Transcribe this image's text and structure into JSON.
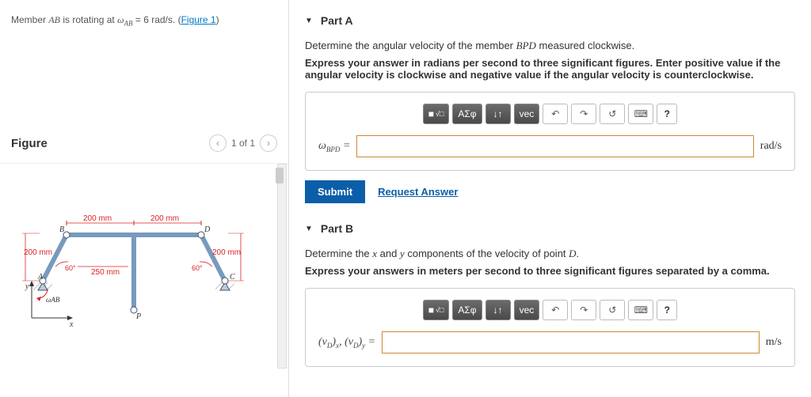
{
  "problem": {
    "prefix": "Member ",
    "member": "AB",
    "middle": " is rotating at ",
    "omega_sym": "ω",
    "omega_sub": "AB",
    "equals": " = 6 rad/s. (",
    "figure_link": "Figure 1",
    "suffix": ")"
  },
  "figure": {
    "title": "Figure",
    "pager": "1 of 1",
    "dims": {
      "top_left": "200 mm",
      "top_right": "200 mm",
      "left": "200 mm",
      "right": "200 mm",
      "bottom": "250 mm",
      "angle_left": "60°",
      "angle_right": "60°",
      "omega": "ωAB",
      "labels": {
        "A": "A",
        "B": "B",
        "C": "C",
        "D": "D",
        "P": "P",
        "x": "x",
        "y": "y"
      }
    }
  },
  "partA": {
    "title": "Part A",
    "question_prefix": "Determine the angular velocity of the member ",
    "question_member": "BPD",
    "question_suffix": " measured clockwise.",
    "instruction": "Express your answer in radians per second to three significant figures. Enter positive value if the angular velocity is clockwise and negative value if the angular velocity is counterclockwise.",
    "label": "ωBPD =",
    "unit": "rad/s",
    "submit": "Submit",
    "request": "Request Answer"
  },
  "partB": {
    "title": "Part B",
    "question_prefix": "Determine the ",
    "q_x": "x",
    "q_and": " and ",
    "q_y": "y",
    "question_suffix": " components of the velocity of point ",
    "q_point": "D",
    "q_end": ".",
    "instruction": "Express your answers in meters per second to three significant figures separated by a comma.",
    "label": "(vD)x, (vD)y =",
    "unit": "m/s"
  },
  "toolbar": {
    "templates": "■",
    "fraction": "x/□",
    "greek": "ΑΣφ",
    "subscript": "↓↑",
    "vec": "vec",
    "undo": "↶",
    "redo": "↷",
    "reset": "↺",
    "keyboard": "⌨",
    "help": "?"
  }
}
